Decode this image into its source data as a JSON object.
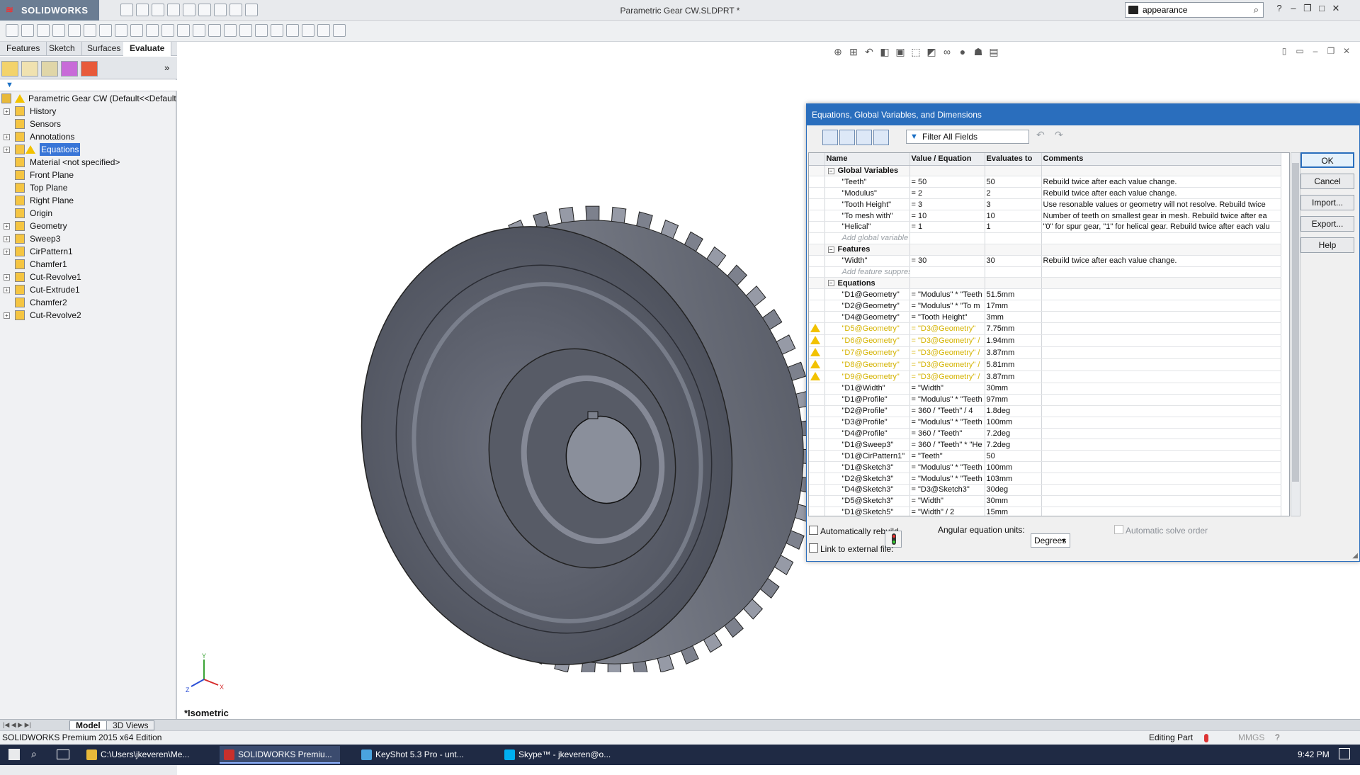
{
  "app": {
    "logo": "SOLIDWORKS",
    "doc_title": "Parametric Gear CW.SLDPRT *",
    "search_value": "appearance"
  },
  "tabs": [
    "Features",
    "Sketch",
    "Surfaces",
    "Evaluate"
  ],
  "tree": {
    "root": "Parametric Gear CW  (Default<<Default",
    "items": [
      {
        "label": "History",
        "icon": "history-icon",
        "expandable": true
      },
      {
        "label": "Sensors",
        "icon": "sensor-icon",
        "expandable": false
      },
      {
        "label": "Annotations",
        "icon": "annotations-icon",
        "expandable": true
      },
      {
        "label": "Equations",
        "icon": "equations-icon",
        "expandable": true,
        "selected": true,
        "warning": true
      },
      {
        "label": "Material <not specified>",
        "icon": "material-icon",
        "expandable": false
      },
      {
        "label": "Front Plane",
        "icon": "plane-icon",
        "expandable": false
      },
      {
        "label": "Top Plane",
        "icon": "plane-icon",
        "expandable": false
      },
      {
        "label": "Right Plane",
        "icon": "plane-icon",
        "expandable": false
      },
      {
        "label": "Origin",
        "icon": "origin-icon",
        "expandable": false
      },
      {
        "label": "Geometry",
        "icon": "sketch-icon",
        "expandable": true
      },
      {
        "label": "Sweep3",
        "icon": "sweep-icon",
        "expandable": true
      },
      {
        "label": "CirPattern1",
        "icon": "pattern-icon",
        "expandable": true
      },
      {
        "label": "Chamfer1",
        "icon": "chamfer-icon",
        "expandable": false
      },
      {
        "label": "Cut-Revolve1",
        "icon": "cut-revolve-icon",
        "expandable": true
      },
      {
        "label": "Cut-Extrude1",
        "icon": "cut-extrude-icon",
        "expandable": true
      },
      {
        "label": "Chamfer2",
        "icon": "chamfer-icon",
        "expandable": false
      },
      {
        "label": "Cut-Revolve2",
        "icon": "cut-revolve-icon",
        "expandable": true
      }
    ]
  },
  "bottom_tabs": [
    "Model",
    "3D Views"
  ],
  "viewport": {
    "orientation_label": "*Isometric",
    "triad": {
      "x": "X",
      "y": "Y",
      "z": "Z"
    }
  },
  "status": {
    "left": "SOLIDWORKS Premium 2015 x64 Edition",
    "mode": "Editing Part",
    "units": "MMGS"
  },
  "taskbar": {
    "items": [
      {
        "label": "C:\\Users\\jkeveren\\Me...",
        "color": "#e8b93a"
      },
      {
        "label": "SOLIDWORKS Premiu...",
        "color": "#c9302c",
        "active": true
      },
      {
        "label": "KeyShot 5.3 Pro - unt...",
        "color": "#4aa3df"
      },
      {
        "label": "Skype™ - jkeveren@o...",
        "color": "#00aff0"
      }
    ],
    "clock": "9:42 PM"
  },
  "dialog": {
    "title": "Equations, Global Variables, and Dimensions",
    "filter_placeholder": "Filter All Fields",
    "columns": [
      "Name",
      "Value / Equation",
      "Evaluates to",
      "Comments"
    ],
    "sections": [
      {
        "title": "Global Variables",
        "rows": [
          {
            "name": "\"Teeth\"",
            "value": "= 50",
            "eval": "50",
            "comment": "Rebuild twice after each value change."
          },
          {
            "name": "\"Modulus\"",
            "value": "= 2",
            "eval": "2",
            "comment": "Rebuild twice after each value change."
          },
          {
            "name": "\"Tooth Height\"",
            "value": "= 3",
            "eval": "3",
            "comment": "Use resonable values or geometry will not resolve. Rebuild twice"
          },
          {
            "name": "\"To mesh with\"",
            "value": "= 10",
            "eval": "10",
            "comment": "Number of teeth on smallest gear in mesh. Rebuild twice after ea"
          },
          {
            "name": "\"Helical\"",
            "value": "= 1",
            "eval": "1",
            "comment": "\"0\" for spur gear, \"1\" for helical gear. Rebuild twice after each valu"
          }
        ],
        "add_label": "Add global variable"
      },
      {
        "title": "Features",
        "rows": [
          {
            "name": "\"Width\"",
            "value": "= 30",
            "eval": "30",
            "comment": "Rebuild twice after each value change."
          }
        ],
        "add_label": "Add feature suppres"
      },
      {
        "title": "Equations",
        "rows": [
          {
            "name": "\"D1@Geometry\"",
            "value": "= \"Modulus\" * \"Teeth",
            "eval": "51.5mm",
            "comment": ""
          },
          {
            "name": "\"D2@Geometry\"",
            "value": "= \"Modulus\" * \"To m",
            "eval": "17mm",
            "comment": ""
          },
          {
            "name": "\"D4@Geometry\"",
            "value": "= \"Tooth Height\"",
            "eval": "3mm",
            "comment": ""
          },
          {
            "name": "\"D5@Geometry\"",
            "value": "= \"D3@Geometry\"",
            "eval": "7.75mm",
            "comment": "",
            "warning": true
          },
          {
            "name": "\"D6@Geometry\"",
            "value": "= \"D3@Geometry\" /",
            "eval": "1.94mm",
            "comment": "",
            "warning": true
          },
          {
            "name": "\"D7@Geometry\"",
            "value": "= \"D3@Geometry\" /",
            "eval": "3.87mm",
            "comment": "",
            "warning": true
          },
          {
            "name": "\"D8@Geometry\"",
            "value": "= \"D3@Geometry\" /",
            "eval": "5.81mm",
            "comment": "",
            "warning": true
          },
          {
            "name": "\"D9@Geometry\"",
            "value": "= \"D3@Geometry\" /",
            "eval": "3.87mm",
            "comment": "",
            "warning": true
          },
          {
            "name": "\"D1@Width\"",
            "value": "= \"Width\"",
            "eval": "30mm",
            "comment": ""
          },
          {
            "name": "\"D1@Profile\"",
            "value": "= \"Modulus\" * \"Teeth",
            "eval": "97mm",
            "comment": ""
          },
          {
            "name": "\"D2@Profile\"",
            "value": "= 360 / \"Teeth\" / 4",
            "eval": "1.8deg",
            "comment": ""
          },
          {
            "name": "\"D3@Profile\"",
            "value": "= \"Modulus\" * \"Teeth",
            "eval": "100mm",
            "comment": ""
          },
          {
            "name": "\"D4@Profile\"",
            "value": "= 360 / \"Teeth\"",
            "eval": "7.2deg",
            "comment": ""
          },
          {
            "name": "\"D1@Sweep3\"",
            "value": "= 360 / \"Teeth\" * \"He",
            "eval": "7.2deg",
            "comment": ""
          },
          {
            "name": "\"D1@CirPattern1\"",
            "value": "= \"Teeth\"",
            "eval": "50",
            "comment": ""
          },
          {
            "name": "\"D1@Sketch3\"",
            "value": "= \"Modulus\" * \"Teeth",
            "eval": "100mm",
            "comment": ""
          },
          {
            "name": "\"D2@Sketch3\"",
            "value": "= \"Modulus\" * \"Teeth",
            "eval": "103mm",
            "comment": ""
          },
          {
            "name": "\"D4@Sketch3\"",
            "value": "= \"D3@Sketch3\"",
            "eval": "30deg",
            "comment": ""
          },
          {
            "name": "\"D5@Sketch3\"",
            "value": "= \"Width\"",
            "eval": "30mm",
            "comment": ""
          },
          {
            "name": "\"D1@Sketch5\"",
            "value": "= \"Width\" / 2",
            "eval": "15mm",
            "comment": ""
          }
        ]
      }
    ],
    "buttons": {
      "ok": "OK",
      "cancel": "Cancel",
      "import": "Import...",
      "export": "Export...",
      "help": "Help"
    },
    "auto_rebuild": "Automatically rebuild",
    "angular_units_label": "Angular equation units:",
    "angular_units_value": "Degrees",
    "auto_solve": "Automatic solve order",
    "link_external": "Link to external file:"
  }
}
